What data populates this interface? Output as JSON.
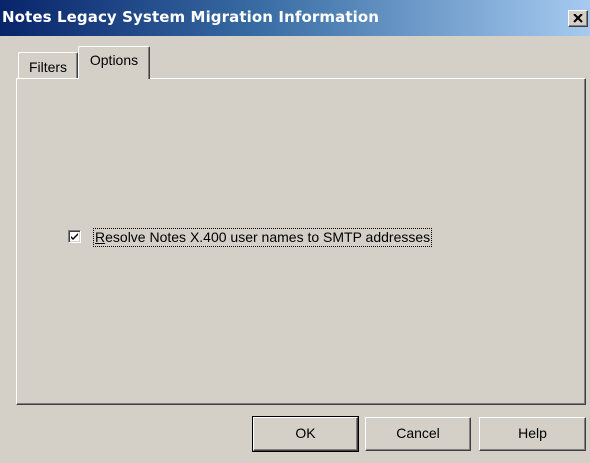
{
  "window": {
    "title": "Notes Legacy System Migration Information"
  },
  "tabs": [
    {
      "label": "Filters",
      "selected": false
    },
    {
      "label": "Options",
      "selected": true
    }
  ],
  "options": {
    "resolve_checkbox": {
      "checked": true,
      "mnemonic": "R",
      "label_rest": "esolve Notes X.400 user names to SMTP addresses"
    }
  },
  "buttons": {
    "ok": "OK",
    "cancel": "Cancel",
    "help": "Help"
  },
  "icons": {
    "close": "close-icon",
    "check": "checkmark-icon"
  }
}
